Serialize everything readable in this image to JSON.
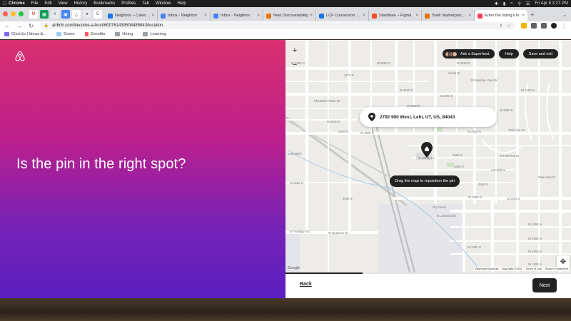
{
  "menubar": {
    "items": [
      "Chrome",
      "File",
      "Edit",
      "View",
      "History",
      "Bookmarks",
      "Profiles",
      "Tab",
      "Window",
      "Help"
    ],
    "datetime": "Fri Apr 8  3:27 PM"
  },
  "tabs": [
    {
      "label": "Neighbor – Calendar",
      "color": "#1a73e8"
    },
    {
      "label": "Inbox - Neighbor",
      "color": "#4285f4"
    },
    {
      "label": "Inbox - Neighbor",
      "color": "#4285f4"
    },
    {
      "label": "New Discoverability",
      "color": "#e8710a"
    },
    {
      "label": "LCF Conversion Rate",
      "color": "#1a73e8"
    },
    {
      "label": "Stashbee – Figma",
      "color": "#f24e1e"
    },
    {
      "label": "Shef: Marketplace i...",
      "color": "#e37400"
    },
    {
      "label": "Enter the listing's lo",
      "color": "#ff385c"
    }
  ],
  "toolbar": {
    "url": "airbnb.com/become-a-host/600761439508485843/location"
  },
  "bookmarks": [
    {
      "label": "ClickUp | Ideas &...",
      "color": "#7b68ee"
    },
    {
      "label": "Domo",
      "color": "#99ccee"
    },
    {
      "label": "Zenefits",
      "color": "#ff5a5f"
    },
    {
      "label": "Hiring",
      "color": "#888888"
    },
    {
      "label": "Learning",
      "color": "#888888"
    }
  ],
  "left": {
    "headline": "Is the pin in the right spot?"
  },
  "map": {
    "zoom_in": "+",
    "zoom_out": "−",
    "ask_superhost": "Ask a Superhost",
    "help": "Help",
    "save_exit": "Save and exit",
    "address": "2792 990 West, Lehi, UT, US, 84043",
    "drag_tip": "Drag the map to reposition the pin",
    "streets": [
      "W 3200 N",
      "W 3200 N",
      "W 3200 N",
      "3175 N",
      "W 3100 N",
      "W 3100 N",
      "W 3000 N",
      "W 2920 N",
      "2910 N",
      "W 2500 N",
      "W 2500 N",
      "2600 N",
      "2600 N",
      "2600 N",
      "Sandhill Dr",
      "Pheasant Pointe Dr",
      "W 2500 N",
      "W 2600 N",
      "W 2600 N",
      "2530 N",
      "N Frontage Rd",
      "W Quantum Dr",
      "Dry Creek",
      "W 2400 N",
      "W 2350 N",
      "W 2300 N",
      "W 2250 N",
      "W 2200 N",
      "N Lakeview Dr",
      "W Parkview Dr",
      "Park View Dr",
      "Trail Side Dr",
      "Canal Dr",
      "W Meadow View Dr",
      "W 2700 N",
      "W 2800 N",
      "Lehi Ditch",
      "W Sandy Lk",
      "W 2900 N"
    ],
    "attribution": [
      "Keyboard shortcuts",
      "Map data ©2022",
      "Terms of Use",
      "Report a map error"
    ],
    "google": "Google",
    "recenter_icon": "move-icon"
  },
  "footer": {
    "back": "Back",
    "next": "Next",
    "progress": 0.27
  }
}
